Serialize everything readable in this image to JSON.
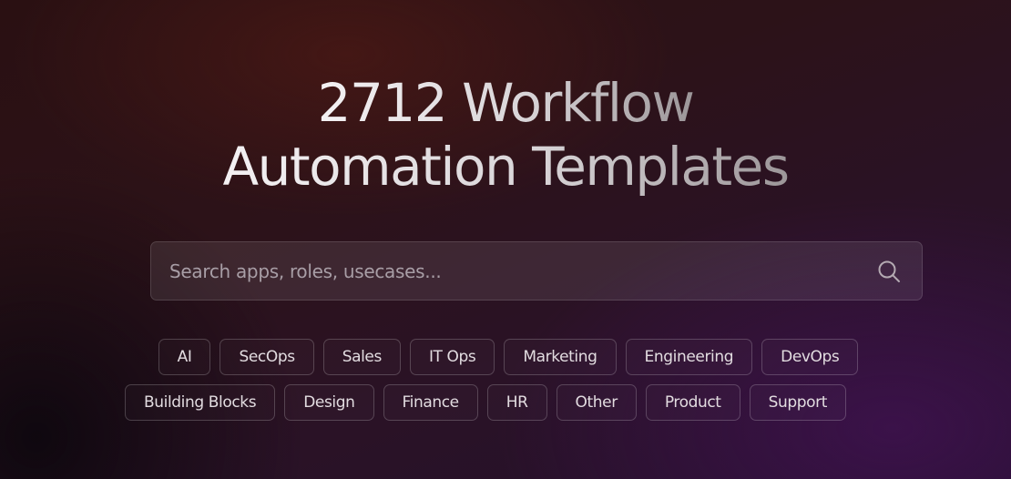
{
  "hero": {
    "title_line1": "2712 Workflow",
    "title_line2": "Automation Templates"
  },
  "search": {
    "placeholder": "Search apps, roles, usecases...",
    "value": "",
    "icon": "search-icon"
  },
  "tags": {
    "row1": [
      "AI",
      "SecOps",
      "Sales",
      "IT Ops",
      "Marketing",
      "Engineering",
      "DevOps"
    ],
    "row2": [
      "Building Blocks",
      "Design",
      "Finance",
      "HR",
      "Other",
      "Product",
      "Support"
    ]
  },
  "colors": {
    "background_top": "#2a1012",
    "background_bottom": "#24102c",
    "text": "#e2dce0",
    "placeholder": "#a89ea6"
  }
}
